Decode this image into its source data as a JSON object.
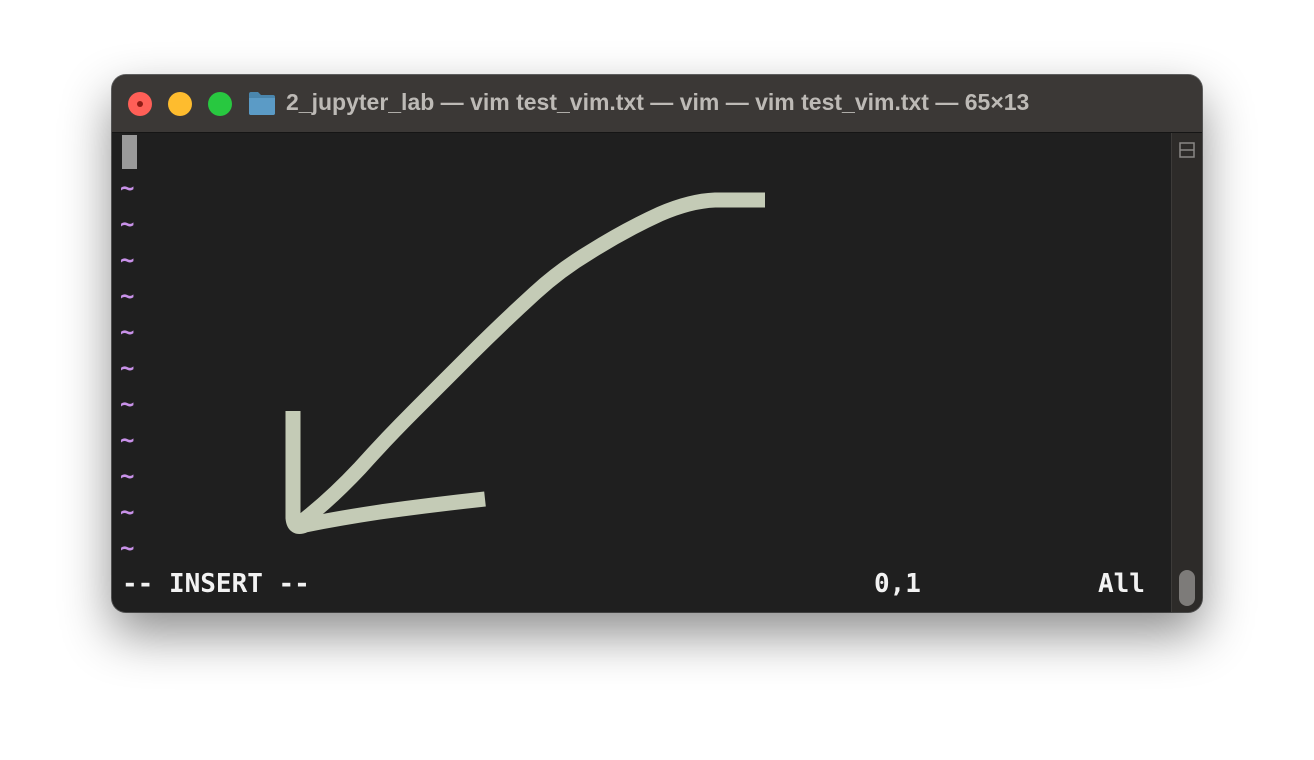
{
  "window": {
    "title": "2_jupyter_lab — vim test_vim.txt — vim — vim test_vim.txt — 65×13"
  },
  "icons": {
    "title": "folder-icon",
    "split": "split-pane-icon"
  },
  "editor": {
    "empty_line_markers": [
      "~",
      "~",
      "~",
      "~",
      "~",
      "~",
      "~",
      "~",
      "~",
      "~",
      "~"
    ],
    "mode": "-- INSERT --",
    "cursor_position": "0,1",
    "scroll_position": "All"
  },
  "colors": {
    "tilde": "#c891e8",
    "annotation_arrow": "#c4cbb6",
    "close": "#ff5f57",
    "minimize": "#febc2e",
    "maximize": "#28c840"
  }
}
